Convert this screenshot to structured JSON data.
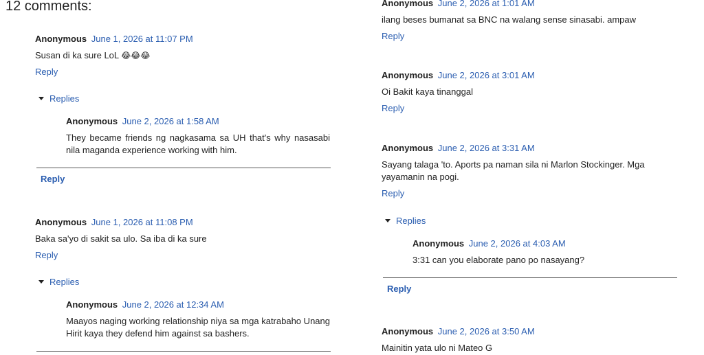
{
  "heading": "12 comments:",
  "reply_label": "Reply",
  "replies_label": "Replies",
  "left": {
    "c1": {
      "author": "Anonymous",
      "date": "June 1, 2026 at 11:07 PM",
      "text": "Susan di ka sure LoL",
      "emoji": "😂😂😂",
      "nested": {
        "author": "Anonymous",
        "date": "June 2, 2026 at 1:58 AM",
        "text": "They became friends ng nagkasama sa UH that's why nasasabi nila maganda experience working with him."
      }
    },
    "c2": {
      "author": "Anonymous",
      "date": "June 1, 2026 at 11:08 PM",
      "text": "Baka sa'yo di sakit sa ulo. Sa iba di ka sure",
      "nested": {
        "author": "Anonymous",
        "date": "June 2, 2026 at 12:34 AM",
        "text": "Maayos naging working relationship niya sa mga katrabaho Unang Hirit kaya they defend him against sa bashers."
      }
    }
  },
  "right": {
    "c1": {
      "author": "Anonymous",
      "date": "June 2, 2026 at 1:01 AM",
      "text": "ilang beses bumanat sa BNC na walang sense sinasabi. ampaw"
    },
    "c2": {
      "author": "Anonymous",
      "date": "June 2, 2026 at 3:01 AM",
      "text": "Oi Bakit kaya tinanggal"
    },
    "c3": {
      "author": "Anonymous",
      "date": "June 2, 2026 at 3:31 AM",
      "text": "Sayang talaga 'to. Aports pa naman sila ni Marlon Stockinger. Mga yayamanin na pogi.",
      "nested": {
        "author": "Anonymous",
        "date": "June 2, 2026 at 4:03 AM",
        "text": "3:31 can you elaborate pano po nasayang?"
      }
    },
    "c4": {
      "author": "Anonymous",
      "date": "June 2, 2026 at 3:50 AM",
      "text": "Mainitin yata ulo ni Mateo G"
    }
  }
}
